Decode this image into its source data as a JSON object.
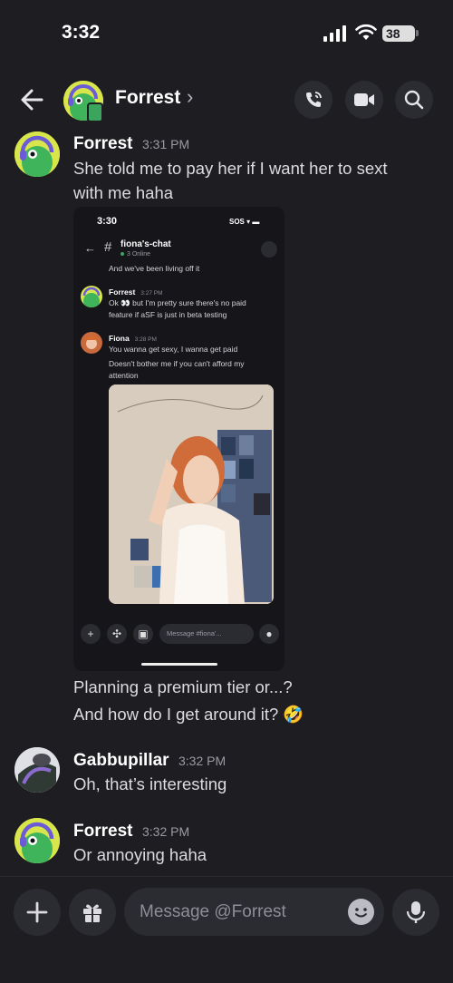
{
  "status_bar": {
    "time": "3:32",
    "battery": "38"
  },
  "header": {
    "title": "Forrest",
    "chevron": "›",
    "back_icon": "arrow-left-icon",
    "call_icon": "phone-call-icon",
    "video_icon": "video-camera-icon",
    "search_icon": "search-icon"
  },
  "messages": [
    {
      "author": "Forrest",
      "time": "3:31 PM",
      "lines": [
        "She told me to pay her if I want her to sext",
        "with me haha"
      ],
      "continuation": [
        "Planning a premium tier or...?",
        "And how do I get around it? 🤣"
      ]
    },
    {
      "author": "Gabbupillar",
      "time": "3:32 PM",
      "lines": [
        "Oh, that’s interesting"
      ]
    },
    {
      "author": "Forrest",
      "time": "3:32 PM",
      "lines": [
        "Or annoying haha"
      ]
    }
  ],
  "embed": {
    "time": "3:30",
    "status": "SOS",
    "channel": "fiona's-chat",
    "online": "3 Online",
    "prev_text": "And we've been living off it",
    "msg1": {
      "author": "Forrest",
      "time": "3:27 PM",
      "lines": [
        "Ok 👀 but I'm pretty sure there's no paid",
        "feature if aSF is just in beta testing"
      ]
    },
    "msg2": {
      "author": "Fiona",
      "time": "3:28 PM",
      "lines": [
        "You wanna get sexy, I wanna get paid",
        "Doesn't bother me if you can't afford my",
        "attention"
      ]
    },
    "composer_placeholder": "Message #fiona'..."
  },
  "composer": {
    "placeholder": "Message @Forrest"
  },
  "colors": {
    "background": "#1d1d22",
    "avatar_yellow": "#d9e64b",
    "accent_green": "#3ba55d"
  }
}
